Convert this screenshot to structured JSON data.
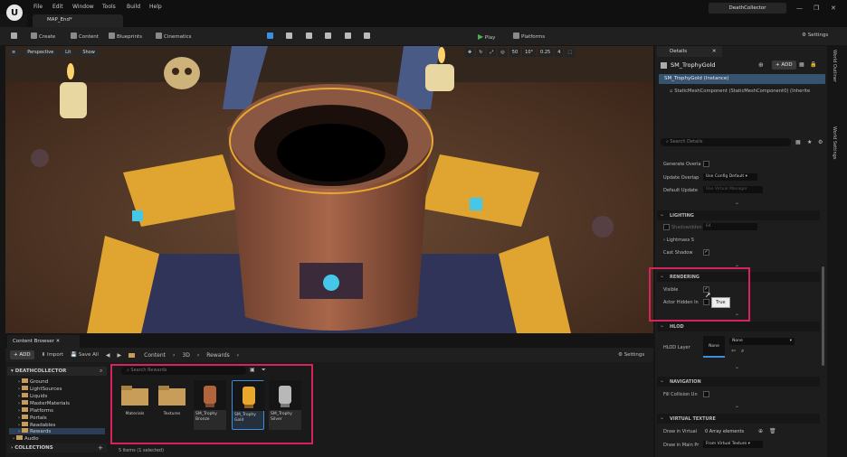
{
  "menu": {
    "items": [
      "File",
      "Edit",
      "Window",
      "Tools",
      "Build",
      "Help"
    ]
  },
  "tab": {
    "title": "MAP_End*"
  },
  "project": {
    "name": "DeathCollector"
  },
  "toolbar": {
    "create": "Create",
    "content": "Content",
    "blueprints": "Blueprints",
    "cinematics": "Cinematics",
    "play": "Play",
    "platforms": "Platforms",
    "settings": "Settings"
  },
  "viewport": {
    "perspective": "Perspective",
    "lit": "Lit",
    "show": "Show",
    "grid": "50",
    "angle": "10°",
    "scale": "0.25",
    "cam": "4"
  },
  "content_browser": {
    "tab": "Content Browser",
    "add": "ADD",
    "import": "Import",
    "save_all": "Save All",
    "breadcrumb": [
      "Content",
      "3D",
      "Rewards"
    ],
    "settings": "Settings",
    "root": "DEATHCOLLECTOR",
    "tree": [
      "Ground",
      "LightSources",
      "Liquids",
      "MasterMaterials",
      "Platforms",
      "Portals",
      "Readables",
      "Rewards",
      "Audio"
    ],
    "collections": "COLLECTIONS",
    "search_placeholder": "Search Rewards",
    "assets": [
      {
        "label": "Materials"
      },
      {
        "label": "Textures"
      },
      {
        "label": "SM_Trophy Bronze"
      },
      {
        "label": "SM_Trophy Gold"
      },
      {
        "label": "SM_Trophy Silver"
      }
    ],
    "status": "5 items (1 selected)"
  },
  "details": {
    "tab": "Details",
    "actor": "SM_TrophyGold",
    "add": "ADD",
    "instance": "SM_TrophyGold (Instance)",
    "component": "StaticMeshComponent (StaticMeshComponent0) (Inherite",
    "search_placeholder": "Search Details",
    "rows_top": [
      {
        "label": "Generate Overla"
      },
      {
        "label": "Update Overlap",
        "value": "Use Config Default"
      },
      {
        "label": "Default Update",
        "value": "Use Virtual Manager"
      }
    ],
    "lighting": "LIGHTING",
    "shadow_label": "Shadowidden",
    "shadow_val": "64",
    "lightmass": "Lightmass S",
    "cast_shadow": "Cast Shadow",
    "rendering": "RENDERING",
    "visible": "Visible",
    "actor_hidden": "Actor Hidden In",
    "tooltip": "True",
    "hlod": "HLOD",
    "hlod_layer": "HLOD Layer",
    "hlod_none": "None",
    "hlod_value": "None",
    "navigation": "NAVIGATION",
    "fill_collision": "Fill Collision Un",
    "virtual_texture": "VIRTUAL TEXTURE",
    "draw_in_virtual": "Draw in Virtual",
    "array": "0 Array elements",
    "draw_in_main": "Draw in Main Pr",
    "from_vt": "From Virtual Texture"
  },
  "side": {
    "outliner": "World Outliner",
    "world_settings": "World Settings"
  },
  "colors": {
    "accent_red": "#d8235a",
    "play_green": "#4caf50",
    "gold": "#e8a830"
  }
}
